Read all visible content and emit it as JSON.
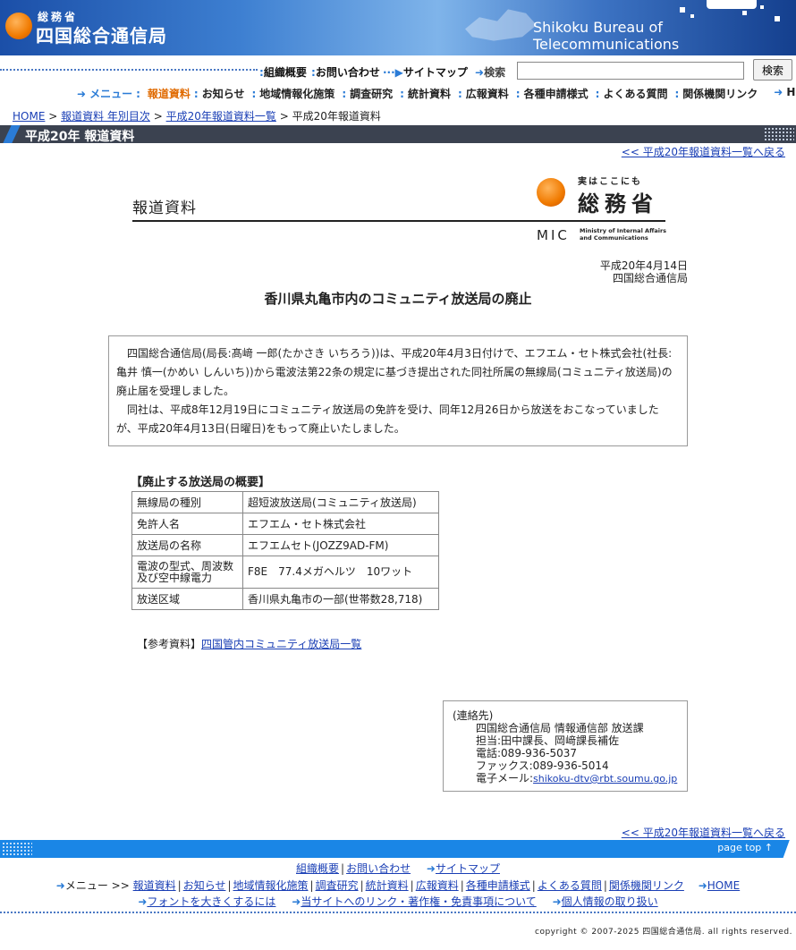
{
  "header": {
    "ministry_small": "総務省",
    "bureau_jp": "四国総合通信局",
    "bureau_en": "Shikoku Bureau of Telecommunications"
  },
  "util_nav": {
    "about": "組織概要",
    "contact": "お問い合わせ",
    "sitemap": "サイトマップ",
    "search_label": "検索",
    "search_value": "",
    "search_button": "検索"
  },
  "main_nav": {
    "menu": "メニュー",
    "items": [
      "報道資料",
      "お知らせ",
      "地域情報化施策",
      "調査研究",
      "統計資料",
      "広報資料",
      "各種申請様式",
      "よくある質問",
      "関係機関リンク"
    ],
    "home": "HOME"
  },
  "breadcrumb": [
    "HOME",
    "報道資料 年別目次",
    "平成20年報道資料一覧",
    "平成20年報道資料"
  ],
  "page_title": "平成20年 報道資料",
  "back_link": "<< 平成20年報道資料一覧へ戻る",
  "report": {
    "label": "報道資料",
    "logo_tag": "実はここにも",
    "logo_ministry": "総務省",
    "logo_abbr": "MIC",
    "logo_en_1": "Ministry of Internal Affairs",
    "logo_en_2": "and Communications",
    "date": "平成20年4月14日",
    "issuer": "四国総合通信局",
    "headline": "香川県丸亀市内のコミュニティ放送局の廃止",
    "lead_1": "四国総合通信局(局長:髙﨑 一郎(たかさき いちろう))は、平成20年4月3日付けで、エフエム・セト株式会社(社長:亀井 慎一(かめい しんいち))から電波法第22条の規定に基づき提出された同社所属の無線局(コミュニティ放送局)の廃止届を受理しました。",
    "lead_2": "同社は、平成8年12月19日にコミュニティ放送局の免許を受け、同年12月26日から放送をおこなっていましたが、平成20年4月13日(日曜日)をもって廃止いたしました。"
  },
  "overview": {
    "heading": "【廃止する放送局の概要】",
    "rows": [
      {
        "key": "無線局の種別",
        "value": "超短波放送局(コミュニティ放送局)"
      },
      {
        "key": "免許人名",
        "value": "エフエム・セト株式会社"
      },
      {
        "key": "放送局の名称",
        "value": "エフエムセト(JOZZ9AD-FM)"
      },
      {
        "key": "電波の型式、周波数及び空中線電力",
        "value": "F8E　77.4メガヘルツ　10ワット"
      },
      {
        "key": "放送区域",
        "value": "香川県丸亀市の一部(世帯数28,718)"
      }
    ]
  },
  "reference": {
    "label": "【参考資料】",
    "link": "四国管内コミュニティ放送局一覧"
  },
  "contact": {
    "heading": "(連絡先)",
    "dept": "四国総合通信局 情報通信部 放送課",
    "person": "担当:田中課長、岡﨑課長補佐",
    "tel": "電話:089-936-5037",
    "fax": "ファックス:089-936-5014",
    "email_label": "電子メール:",
    "email": "shikoku-dtv@rbt.soumu.go.jp"
  },
  "footer": {
    "page_top": "page top ↑",
    "row1": [
      "組織概要",
      "お問い合わせ",
      "サイトマップ"
    ],
    "menu_label": "メニュー >>",
    "row2": [
      "報道資料",
      "お知らせ",
      "地域情報化施策",
      "調査研究",
      "統計資料",
      "広報資料",
      "各種申請様式",
      "よくある質問",
      "関係機関リンク"
    ],
    "home": "HOME",
    "row3": [
      "フォントを大きくするには",
      "当サイトへのリンク・著作権・免責事項について",
      "個人情報の取り扱い"
    ],
    "copyright": "copyright © 2007-2025 四国総合通信局. all rights reserved."
  }
}
